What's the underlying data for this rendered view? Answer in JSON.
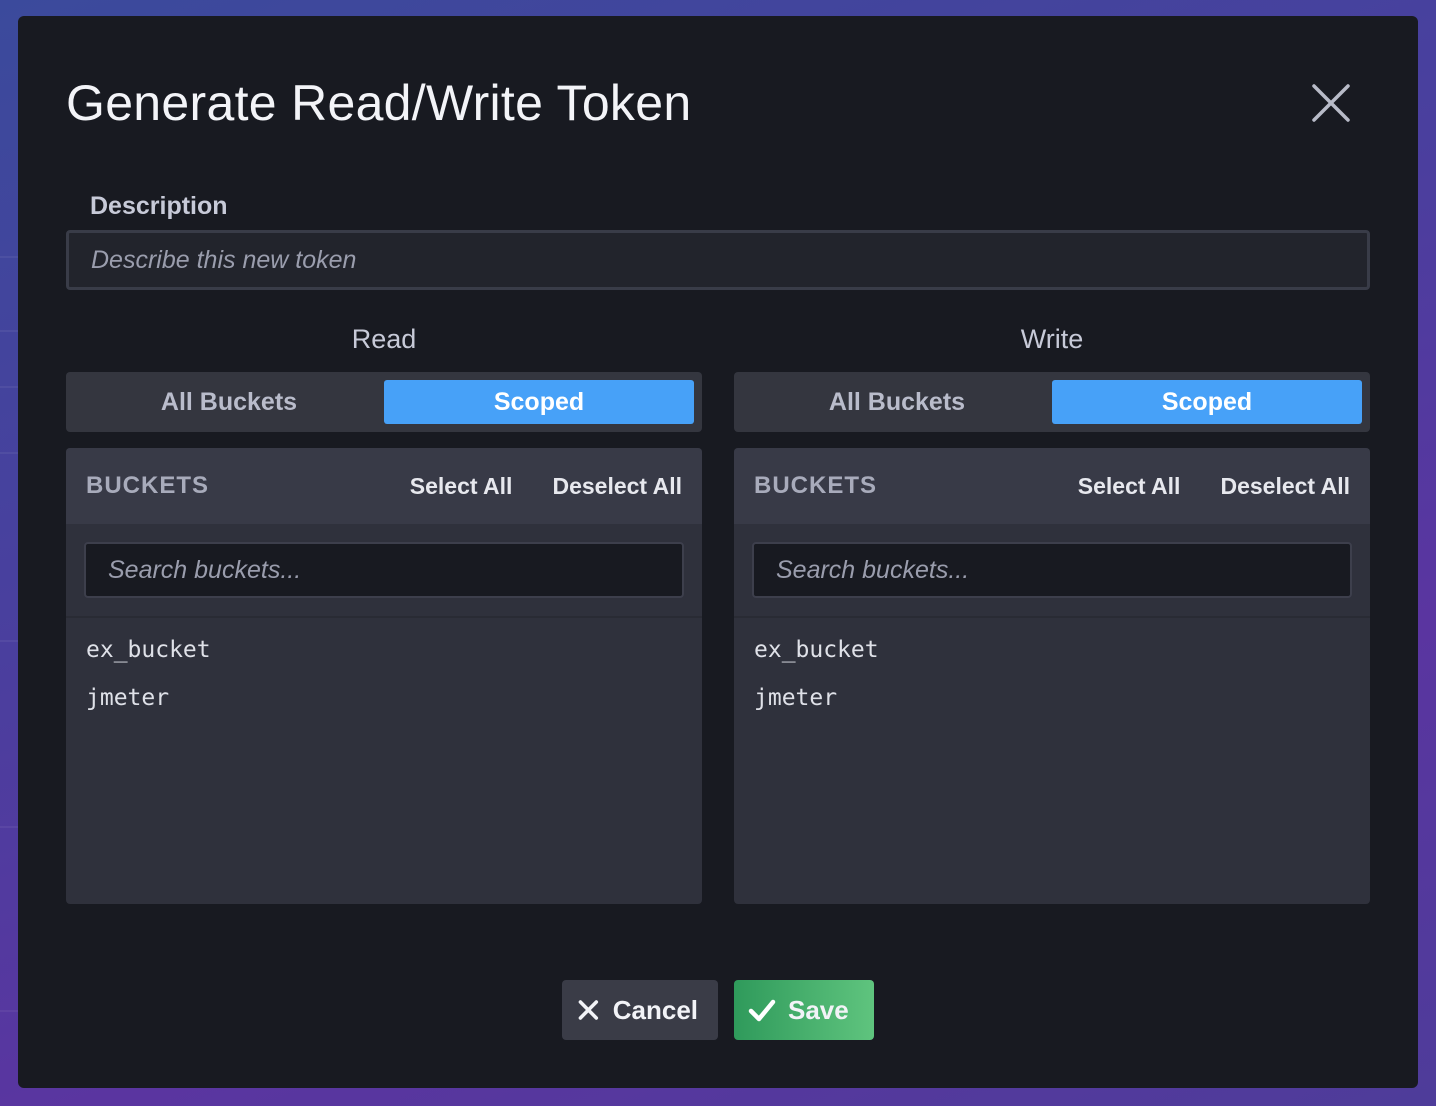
{
  "modal": {
    "title": "Generate Read/Write Token",
    "close_icon": "close-icon"
  },
  "description": {
    "label": "Description",
    "placeholder": "Describe this new token",
    "value": ""
  },
  "read": {
    "title": "Read",
    "toggle": {
      "all_label": "All Buckets",
      "scoped_label": "Scoped",
      "selected": "Scoped"
    },
    "buckets": {
      "header": "BUCKETS",
      "select_all": "Select All",
      "deselect_all": "Deselect All",
      "search_placeholder": "Search buckets...",
      "items": [
        "ex_bucket",
        "jmeter"
      ]
    }
  },
  "write": {
    "title": "Write",
    "toggle": {
      "all_label": "All Buckets",
      "scoped_label": "Scoped",
      "selected": "Scoped"
    },
    "buckets": {
      "header": "BUCKETS",
      "select_all": "Select All",
      "deselect_all": "Deselect All",
      "search_placeholder": "Search buckets...",
      "items": [
        "ex_bucket",
        "jmeter"
      ]
    }
  },
  "footer": {
    "cancel_label": "Cancel",
    "save_label": "Save"
  },
  "colors": {
    "accent": "#47a1f8",
    "save": "#4cb56f",
    "modal_bg": "#181a21"
  }
}
